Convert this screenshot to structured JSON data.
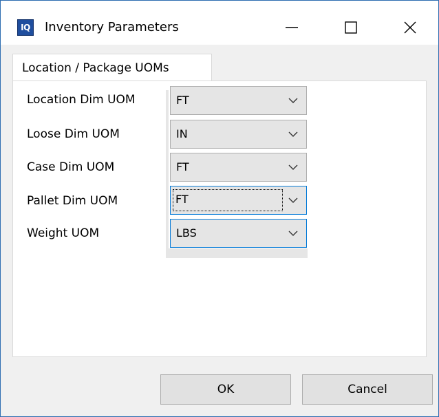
{
  "window": {
    "title": "Inventory Parameters",
    "icon_text": "IQ",
    "icon_name": "app-iq-icon"
  },
  "tabs": [
    {
      "label": "Location / Package UOMs",
      "active": true
    }
  ],
  "fields": [
    {
      "label": "Location Dim UOM",
      "value": "FT"
    },
    {
      "label": "Loose Dim UOM",
      "value": "IN"
    },
    {
      "label": "Case Dim UOM",
      "value": "FT"
    },
    {
      "label": "Pallet Dim UOM",
      "value": "FT",
      "focused": true
    },
    {
      "label": "Weight UOM",
      "value": "LBS"
    }
  ],
  "buttons": {
    "ok": "OK",
    "cancel": "Cancel"
  },
  "colors": {
    "focus_border": "#0078d7",
    "icon_bg": "#1f4e9e"
  }
}
